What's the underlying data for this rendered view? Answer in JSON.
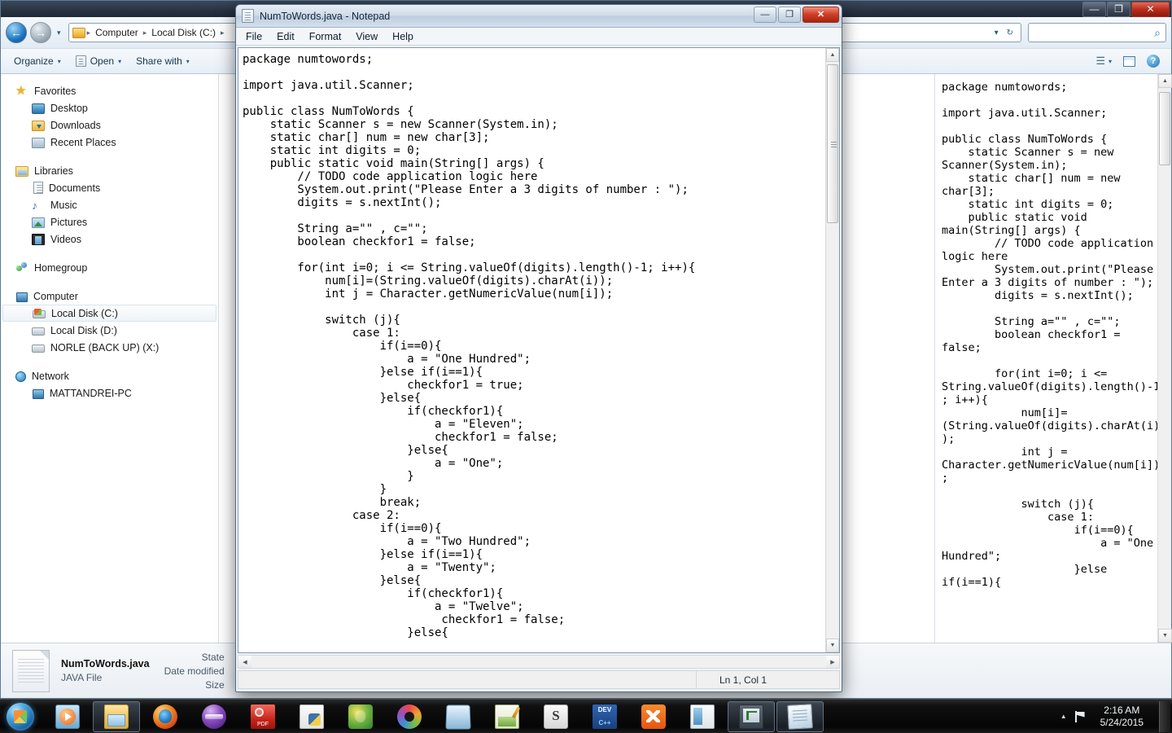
{
  "explorer": {
    "window_controls": {
      "minimize": "—",
      "maximize": "❐",
      "close": "✕"
    },
    "breadcrumb": {
      "items": [
        "Computer",
        "Local Disk (C:)"
      ],
      "separator": "▸"
    },
    "address_refresh": "↻",
    "address_dropdown": "▾",
    "search": {
      "placeholder": "",
      "icon": "search-icon"
    },
    "toolbar": {
      "organize": "Organize",
      "open": "Open",
      "share_with": "Share with",
      "caret": "▾"
    },
    "sidebar": {
      "groups": [
        {
          "header": {
            "label": "Favorites",
            "icon": "star-icon"
          },
          "items": [
            {
              "label": "Desktop",
              "icon": "desktop-icon"
            },
            {
              "label": "Downloads",
              "icon": "downloads-icon"
            },
            {
              "label": "Recent Places",
              "icon": "recent-places-icon"
            }
          ]
        },
        {
          "header": {
            "label": "Libraries",
            "icon": "libraries-icon"
          },
          "items": [
            {
              "label": "Documents",
              "icon": "documents-icon"
            },
            {
              "label": "Music",
              "icon": "music-icon"
            },
            {
              "label": "Pictures",
              "icon": "pictures-icon"
            },
            {
              "label": "Videos",
              "icon": "videos-icon"
            }
          ]
        },
        {
          "header": {
            "label": "Homegroup",
            "icon": "homegroup-icon"
          },
          "items": []
        },
        {
          "header": {
            "label": "Computer",
            "icon": "computer-icon"
          },
          "items": [
            {
              "label": "Local Disk (C:)",
              "icon": "windows-drive-icon",
              "selected": true
            },
            {
              "label": "Local Disk (D:)",
              "icon": "drive-icon"
            },
            {
              "label": "NORLE (BACK UP) (X:)",
              "icon": "drive-icon"
            }
          ]
        },
        {
          "header": {
            "label": "Network",
            "icon": "network-icon"
          },
          "items": [
            {
              "label": "MATTANDREI-PC",
              "icon": "computer-icon"
            }
          ]
        }
      ]
    },
    "details_pane": {
      "file_name": "NumToWords.java",
      "file_type": "JAVA File",
      "labels": [
        "State",
        "Date modified",
        "Size"
      ]
    },
    "preview_pane": {
      "text": "package numtowords;\n\nimport java.util.Scanner;\n\npublic class NumToWords {\n    static Scanner s = new Scanner(System.in);\n    static char[] num = new char[3];\n    static int digits = 0;\n    public static void main(String[] args) {\n        // TODO code application logic here\n        System.out.print(\"Please Enter a 3 digits of number : \");\n        digits = s.nextInt();\n\n        String a=\"\" , c=\"\";\n        boolean checkfor1 = false;\n\n        for(int i=0; i <= String.valueOf(digits).length()-1; i++){\n            num[i]=(String.valueOf(digits).charAt(i));\n            int j = Character.getNumericValue(num[i]);\n\n            switch (j){\n                case 1:\n                    if(i==0){\n                        a = \"One Hundred\";\n                    }else if(i==1){"
    }
  },
  "notepad": {
    "title": "NumToWords.java - Notepad",
    "icon": "notepad-icon",
    "window_controls": {
      "minimize": "—",
      "maximize": "❐",
      "close": "✕"
    },
    "menu": [
      "File",
      "Edit",
      "Format",
      "View",
      "Help"
    ],
    "status": "Ln 1, Col 1",
    "scroll": {
      "up": "▲",
      "down": "▼",
      "left": "◀",
      "right": "▶"
    },
    "content": "package numtowords;\n\nimport java.util.Scanner;\n\npublic class NumToWords {\n    static Scanner s = new Scanner(System.in);\n    static char[] num = new char[3];\n    static int digits = 0;\n    public static void main(String[] args) {\n        // TODO code application logic here\n        System.out.print(\"Please Enter a 3 digits of number : \");\n        digits = s.nextInt();\n\n        String a=\"\" , c=\"\";\n        boolean checkfor1 = false;\n\n        for(int i=0; i <= String.valueOf(digits).length()-1; i++){\n            num[i]=(String.valueOf(digits).charAt(i));\n            int j = Character.getNumericValue(num[i]);\n\n            switch (j){\n                case 1:\n                    if(i==0){\n                        a = \"One Hundred\";\n                    }else if(i==1){\n                        checkfor1 = true;\n                    }else{\n                        if(checkfor1){\n                            a = \"Eleven\";\n                            checkfor1 = false;\n                        }else{\n                            a = \"One\";\n                        }\n                    }\n                    break;\n                case 2:\n                    if(i==0){\n                        a = \"Two Hundred\";\n                    }else if(i==1){\n                        a = \"Twenty\";\n                    }else{\n                        if(checkfor1){\n                            a = \"Twelve\";\n                             checkfor1 = false;\n                        }else{"
  },
  "taskbar": {
    "start": {
      "icon": "windows-start-orb"
    },
    "apps": [
      {
        "name": "windows-media-player",
        "icon": "media-player-icon",
        "active": false
      },
      {
        "name": "windows-explorer",
        "icon": "folder-icon",
        "active": true
      },
      {
        "name": "firefox",
        "icon": "firefox-icon",
        "active": false
      },
      {
        "name": "eclipse",
        "icon": "eclipse-icon",
        "active": false
      },
      {
        "name": "adobe-reader",
        "icon": "pdf-icon",
        "active": false
      },
      {
        "name": "python",
        "icon": "python-icon",
        "active": false
      },
      {
        "name": "pycharm",
        "icon": "pycharm-icon",
        "active": false
      },
      {
        "name": "visual-studio",
        "icon": "visual-studio-icon",
        "active": false
      },
      {
        "name": "virtualbox",
        "icon": "virtualbox-icon",
        "active": false
      },
      {
        "name": "notepad-plus-plus",
        "icon": "notepad-plus-plus-icon",
        "active": false
      },
      {
        "name": "sublime-text",
        "icon": "sublime-icon",
        "active": false
      },
      {
        "name": "dev-cpp",
        "icon": "dev-cpp-icon",
        "active": false
      },
      {
        "name": "xampp",
        "icon": "xampp-icon",
        "active": false
      },
      {
        "name": "window-app",
        "icon": "window-icon",
        "active": false
      },
      {
        "name": "netbeans",
        "icon": "netbeans-icon",
        "active": true
      },
      {
        "name": "notepad",
        "icon": "notepad-icon",
        "active": true
      }
    ],
    "tray": {
      "caret": "▲",
      "flag_icon": "action-center-flag-icon",
      "time": "2:16 AM",
      "date": "5/24/2015"
    }
  }
}
